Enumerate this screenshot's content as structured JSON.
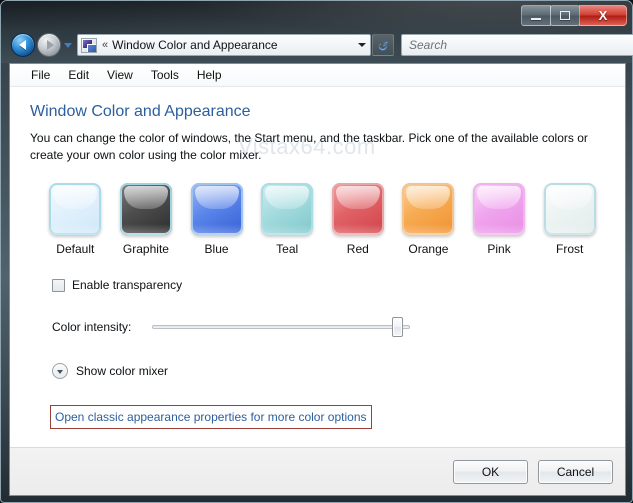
{
  "window": {
    "title": "Window Color and Appearance",
    "caption_buttons": {
      "minimize": "minimize",
      "maximize": "maximize",
      "close": "X"
    }
  },
  "navbar": {
    "back_label": "Back",
    "forward_label": "Forward",
    "address_chevron": "«",
    "address_text": "Window Color and Appearance",
    "refresh_glyph": "↺",
    "search_placeholder": "Search",
    "search_value": "",
    "search_icon": "⚲"
  },
  "menubar": {
    "items": [
      {
        "label": "File"
      },
      {
        "label": "Edit"
      },
      {
        "label": "View"
      },
      {
        "label": "Tools"
      },
      {
        "label": "Help"
      }
    ]
  },
  "watermark": "Vistax64.com",
  "page": {
    "title": "Window Color and Appearance",
    "description": "You can change the color of windows, the Start menu, and the taskbar. Pick one of the available colors or create your own color using the color mixer."
  },
  "swatches": [
    {
      "label": "Default",
      "color": "#dceefb",
      "gradient": "linear-gradient(150deg, #f4fbff 0%, #e1f1fc 45%, #cfe7f8 100%)",
      "border": "#a9dbe8"
    },
    {
      "label": "Graphite",
      "color": "#4a4a4a",
      "gradient": "linear-gradient(150deg, #7e7e7e 0%, #4d4d4d 45%, #2c2c2c 100%)",
      "border": "#9fd3e0"
    },
    {
      "label": "Blue",
      "color": "#4d7fe8",
      "gradient": "linear-gradient(150deg, #9db6f2 0%, #5b86ea 45%, #345fd6 100%)",
      "border": "#9fc2ee"
    },
    {
      "label": "Teal",
      "color": "#9ad6d8",
      "gradient": "linear-gradient(150deg, #cfeef0 0%, #a4dcdf 45%, #7ec6ca 100%)",
      "border": "#a9dde4"
    },
    {
      "label": "Red",
      "color": "#e2676c",
      "gradient": "linear-gradient(150deg, #f0a0a2 0%, #e06367 45%, #d04248 100%)",
      "border": "#e8a6a8"
    },
    {
      "label": "Orange",
      "color": "#f5a council",
      "gradient": "linear-gradient(150deg, #fbd19a 0%, #f7ab53 45%, #f0912f 100%)",
      "border": "#f3c48e"
    },
    {
      "label": "Pink",
      "color": "#f0a6ee",
      "gradient": "linear-gradient(150deg, #fad5f7 0%, #f0a5ee 45%, #e88ce4 100%)",
      "border": "#efb4ec"
    },
    {
      "label": "Frost",
      "color": "#eef4f3",
      "gradient": "linear-gradient(150deg, #fdfefe 0%, #edf4f3 45%, #e2ecea 100%)",
      "border": "#b9dde3"
    }
  ],
  "transparency": {
    "label": "Enable transparency",
    "checked": false
  },
  "intensity": {
    "label": "Color intensity:",
    "value": 97
  },
  "mixer": {
    "label": "Show color mixer",
    "icon": "chevron-down-icon"
  },
  "classic_link": {
    "label": "Open classic appearance properties for more color options",
    "focus_border_color": "#9b3f3a"
  },
  "footer": {
    "ok_label": "OK",
    "cancel_label": "Cancel"
  }
}
